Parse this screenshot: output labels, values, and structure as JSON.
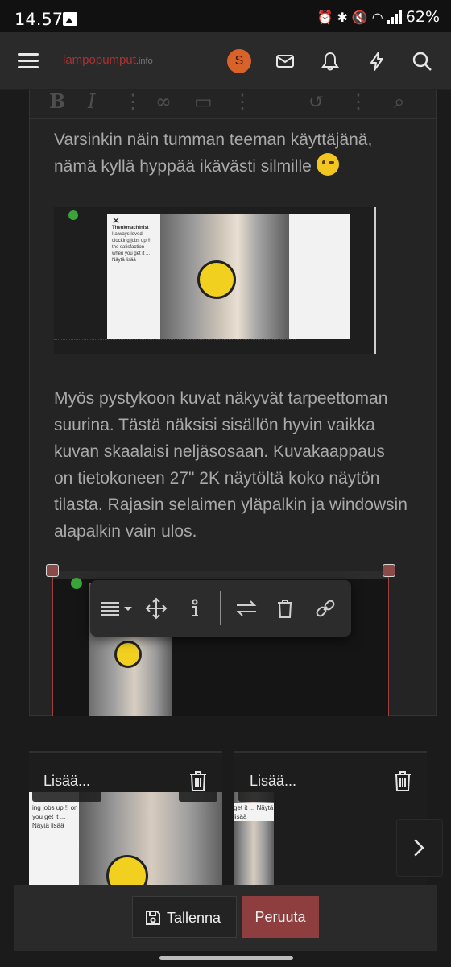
{
  "status_bar": {
    "time": "14.57",
    "battery": "62%",
    "icons": [
      "gallery-icon",
      "alarm-icon",
      "bluetooth-icon",
      "mute-icon",
      "wifi-icon",
      "signal-icon"
    ]
  },
  "header": {
    "logo_main": "lampopumput",
    "logo_suffix": ".info",
    "avatar_letter": "S",
    "icons": [
      "menu-icon",
      "mail-icon",
      "bell-icon",
      "lightning-icon",
      "search-icon"
    ],
    "brand_color": "#b03030",
    "avatar_color": "#d9622a"
  },
  "editor": {
    "toolbar_icons": [
      "bold-icon",
      "italic-icon",
      "more-icon",
      "link-icon",
      "image-icon",
      "more-icon",
      "undo-icon",
      "more-icon",
      "preview-icon"
    ],
    "paragraph1": "Varsinkin näin tumman teeman käyttäjänä, nämä kyllä hyppää ikävästi silmille",
    "paragraph2": "Myös pystykoon kuvat näkyvät tarpeettoman suurina. Tästä näksisi sisällön hyvin vaikka kuvan skaalaisi neljäsosaan. Kuvakaappaus on tietokoneen 27\" 2K näytöltä koko näytön tilasta. Rajasin selaimen yläpalkin ja windowsin alapalkin vain ulos.",
    "embedded_caption": "I always loved clocking jobs up !! the satisfaction when you get it ... Näytä lisää",
    "embedded_author": "Theukmachinist",
    "image_toolbar_icons": [
      "align-icon",
      "move-icon",
      "alt-text-icon",
      "swap-icon",
      "trash-icon",
      "link-icon"
    ]
  },
  "attachments": {
    "items": [
      {
        "insert_label": "Lisää...",
        "caption": "ing jobs up !! on you get it ... Näytä lisää"
      },
      {
        "insert_label": "Lisää...",
        "caption": "get it ... Näytä lisää"
      }
    ],
    "next_icon": "chevron-right-icon"
  },
  "actions": {
    "save_label": "Tallenna",
    "cancel_label": "Peruuta",
    "cancel_color": "#8e3e3e"
  }
}
